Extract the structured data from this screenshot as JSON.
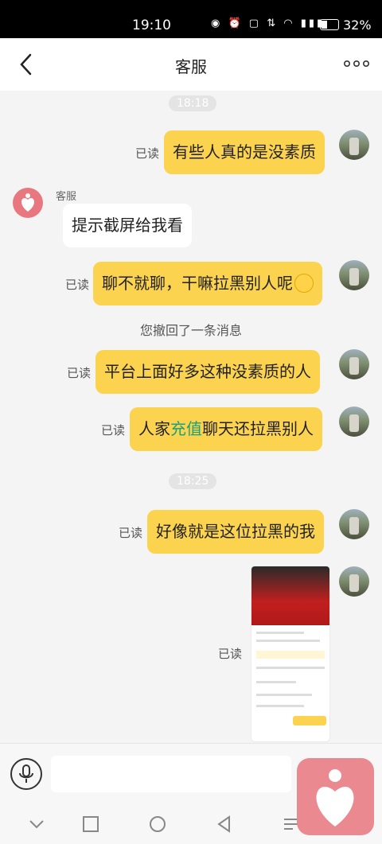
{
  "status_bar": {
    "time": "19:10",
    "battery": "32%"
  },
  "header": {
    "title": "客服"
  },
  "timestamps": [
    "18:18",
    "18:25"
  ],
  "support_sender": "客服",
  "messages": {
    "m1": {
      "text": "有些人真的是没素质",
      "read": "已读"
    },
    "m2": {
      "text": "提示截屏给我看"
    },
    "m3": {
      "text": "聊不就聊，干嘛拉黑别人呢",
      "read": "已读"
    },
    "recall_notice": "您撤回了一条消息",
    "m4": {
      "text": "平台上面好多这种没素质的人",
      "read": "已读"
    },
    "m5": {
      "prefix": "人家",
      "highlight": "充值",
      "suffix": "聊天还拉黑别人",
      "read": "已读"
    },
    "m6": {
      "text": "好像就是这位拉黑的我",
      "read": "已读"
    },
    "m7": {
      "type": "image",
      "read": "已读"
    }
  },
  "input": {
    "placeholder": ""
  },
  "icons": [
    "back-arrow-icon",
    "more-dots-icon",
    "mic-icon",
    "heart-icon",
    "grin-emoji-icon"
  ],
  "colors": {
    "my_bubble": "#fcd34f",
    "their_bubble": "#ffffff",
    "highlight": "#1aa07a",
    "brand": "#ea8a90"
  }
}
